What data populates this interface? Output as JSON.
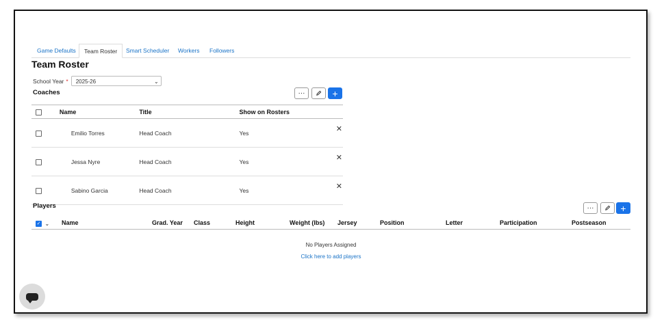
{
  "tabs": [
    "Game Defaults",
    "Team Roster",
    "Smart Scheduler",
    "Workers",
    "Followers"
  ],
  "page_title": "Team Roster",
  "school_year": {
    "label": "School Year",
    "required_mark": "*",
    "value": "2025-26"
  },
  "coaches": {
    "title": "Coaches",
    "columns": [
      "Name",
      "Title",
      "Show on Rosters"
    ],
    "rows": [
      {
        "name": "Emilio Torres",
        "title": "Head Coach",
        "show": "Yes"
      },
      {
        "name": "Jessa Nyre",
        "title": "Head Coach",
        "show": "Yes"
      },
      {
        "name": "Sabino Garcia",
        "title": "Head Coach",
        "show": "Yes"
      }
    ]
  },
  "players": {
    "title": "Players",
    "columns": [
      "Name",
      "Grad. Year",
      "Class",
      "Height",
      "Weight (lbs)",
      "Jersey",
      "Position",
      "Letter",
      "Participation",
      "Postseason"
    ],
    "empty_text": "No Players Assigned",
    "add_link": "Click here to add players"
  },
  "buttons": {
    "more": "···",
    "edit_icon": "pencil-icon",
    "add": "+"
  },
  "colors": {
    "accent": "#1a73e8",
    "link": "#1a73c7",
    "required": "#dd3333"
  }
}
